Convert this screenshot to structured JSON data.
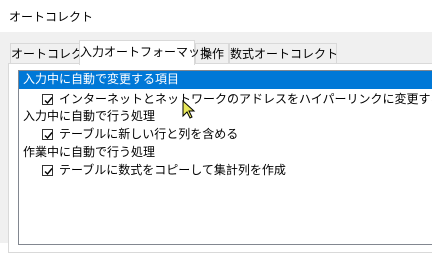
{
  "window": {
    "title": "オートコレクト"
  },
  "tabs": [
    {
      "label": "オートコレクト"
    },
    {
      "label": "入力オートフォーマット"
    },
    {
      "label": "操作"
    },
    {
      "label": "数式オートコレクト"
    }
  ],
  "list": {
    "header_selected": "入力中に自動で変更する項目",
    "item1": "インターネットとネットワークのアドレスをハイパーリンクに変更する",
    "section2": "入力中に自動で行う処理",
    "item2": "テーブルに新しい行と列を含める",
    "section3": "作業中に自動で行う処理",
    "item3": "テーブルに数式をコピーして集計列を作成"
  },
  "colors": {
    "selection": "#0078d7",
    "cursor": "#e8e85a"
  },
  "checks": {
    "item1": true,
    "item2": true,
    "item3": true
  }
}
